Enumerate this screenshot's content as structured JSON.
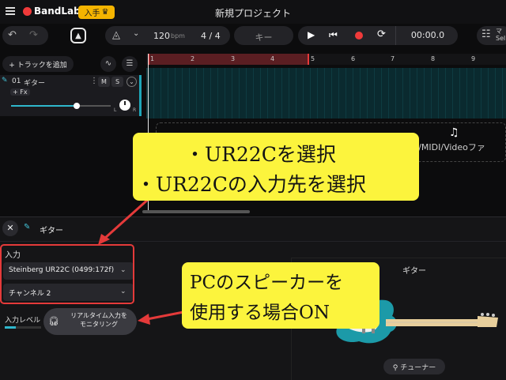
{
  "topbar": {
    "brand": "BandLab",
    "upgrade_label": "入手",
    "upgrade_icon": "crown-icon",
    "project_title": "新規プロジェクト"
  },
  "transport": {
    "tempo": "120",
    "tempo_unit": "bpm",
    "time_signature": "4 / 4",
    "key_label": "キー",
    "time": "00:00.0",
    "settings_label_line1": "マ",
    "settings_label_line2": "Sel"
  },
  "tracks_toolbar": {
    "add_track_label": "+ トラックを追加"
  },
  "track": {
    "number": "01",
    "name": "ギター",
    "mute": "M",
    "solo": "S",
    "fx_label": "+ Fx",
    "pan_left": "L",
    "pan_right": "R",
    "volume_level": 0.66
  },
  "timeline": {
    "ticks": [
      "1",
      "2",
      "3",
      "4",
      "5",
      "6",
      "7",
      "8",
      "9"
    ],
    "drop_text": "ップまたはオーディオ/MIDI/Videoファ"
  },
  "bottom_panel": {
    "title": "ギター",
    "input_label": "入力",
    "device": "Steinberg UR22C (0499:172f)",
    "channel": "チャンネル 2",
    "level_label": "入力レベル",
    "level_value": 0.3,
    "monitor_line1": "リアルタイム入力を",
    "monitor_line2": "モニタリング",
    "guitar_name": "ギター",
    "tuner_label": "チューナー"
  },
  "annotations": {
    "callout1_line1": "・UR22Cを選択",
    "callout1_line2": "・UR22Cの入力先を選択",
    "callout2_line1": "PCのスピーカーを",
    "callout2_line2": "使用する場合ON",
    "highlight_color": "#fcf43d",
    "arrow_color": "#e43a3a"
  },
  "colors": {
    "accent": "#2fb7cc",
    "record": "#f03a3a",
    "upgrade": "#f4b400"
  }
}
